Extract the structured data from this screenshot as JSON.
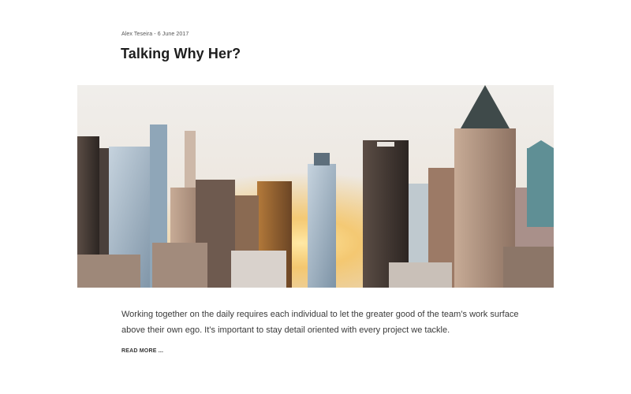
{
  "post": {
    "meta": "Alex Teseira - 6 June 2017",
    "title": "Talking Why Her?",
    "hero_image": "city skyline at sunset",
    "excerpt": "Working together on the daily requires each individual to let the greater good of the team’s work surface above their own ego. It’s important to stay detail oriented with every project we tackle.",
    "read_more_label": "READ MORE ..."
  },
  "colors": {
    "sky_top": "#eceae7",
    "sun_glow": "#f6c25a",
    "building_dark": "#3b3330",
    "building_glass": "#9fb3c2",
    "building_tan": "#b79a86"
  }
}
